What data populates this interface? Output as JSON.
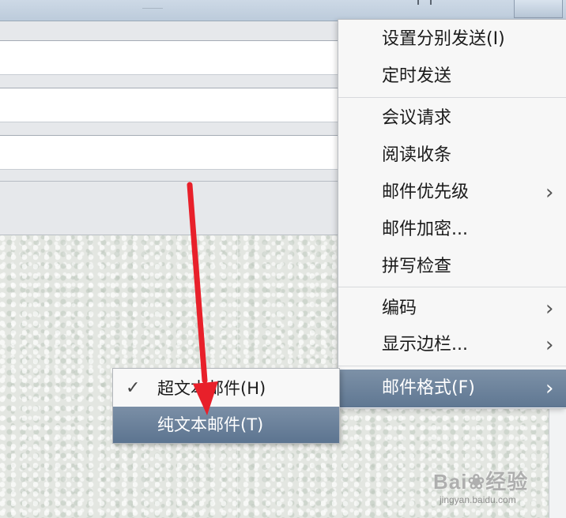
{
  "menu": {
    "items": [
      {
        "label": "设置分别发送(I)",
        "has_submenu": false
      },
      {
        "label": "定时发送",
        "has_submenu": false
      },
      {
        "label": "会议请求",
        "has_submenu": false
      },
      {
        "label": "阅读收条",
        "has_submenu": false
      },
      {
        "label": "邮件优先级",
        "has_submenu": true
      },
      {
        "label": "邮件加密...",
        "has_submenu": false
      },
      {
        "label": "拼写检查",
        "has_submenu": false
      },
      {
        "label": "编码",
        "has_submenu": true
      },
      {
        "label": "显示边栏...",
        "has_submenu": true
      },
      {
        "label": "邮件格式(F)",
        "has_submenu": true,
        "active": true
      }
    ],
    "arrow_glyph": "›"
  },
  "submenu": {
    "items": [
      {
        "label": "超文本邮件(H)",
        "checked": true
      },
      {
        "label": "纯文本邮件(T)",
        "checked": false,
        "highlighted": true
      }
    ],
    "check_glyph": "✓"
  },
  "watermark": {
    "logo": "Bai❀经验",
    "sub": "jingyan.baidu.com"
  },
  "colors": {
    "menu_highlight": "#6a8099",
    "annotation_arrow": "#e8202a"
  }
}
